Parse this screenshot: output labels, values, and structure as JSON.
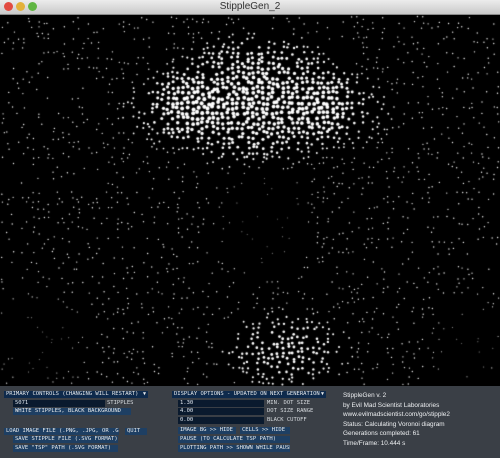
{
  "window": {
    "title": "StippleGen_2"
  },
  "controls": {
    "primary_dropdown": "PRIMARY CONTROLS (CHANGING WILL RESTART)",
    "stipples_value": "5071",
    "stipples_label": "STIPPLES",
    "white_stipples_button": "WHITE STIPPLES, BLACK BACKGROUND",
    "load_image_button": "LOAD IMAGE FILE (.PNG, .JPG, OR .GIF)",
    "quit_button": "QUIT",
    "save_stipple_button": "SAVE STIPPLE FILE (.SVG FORMAT)",
    "save_tsp_button": "SAVE \"TSP\" PATH (.SVG FORMAT)",
    "display_dropdown": "DISPLAY OPTIONS - UPDATED ON NEXT GENERATION",
    "min_dot_value": "1.30",
    "min_dot_label": "MIN. DOT SIZE",
    "dot_range_value": "4.00",
    "dot_range_label": "DOT SIZE RANGE",
    "black_cutoff_value": "0.00",
    "black_cutoff_label": "BLACK CUTOFF",
    "image_bg_button": "IMAGE BG >> HIDE",
    "cells_button": "CELLS >> HIDE",
    "pause_button": "PAUSE (TO CALCULATE TSP PATH)",
    "plotting_button": "PLOTTING PATH >> SHOWN WHILE PAUSED"
  },
  "info": {
    "version": "StippleGen v. 2",
    "byline": "by Evil Mad Scientist Laboratories",
    "url": "www.evilmadscientist.com/go/stipple2",
    "status": "Status: Calculating Voronoi diagram",
    "generations": "Generations completed: 61",
    "time": "Time/Frame: 10.444 s"
  },
  "colors": {
    "panel_bg": "#3a3f46",
    "button_bg": "#1e3f63",
    "field_bg": "#0a1a2e",
    "canvas_bg": "#000000",
    "stipple": "#ffffff"
  }
}
